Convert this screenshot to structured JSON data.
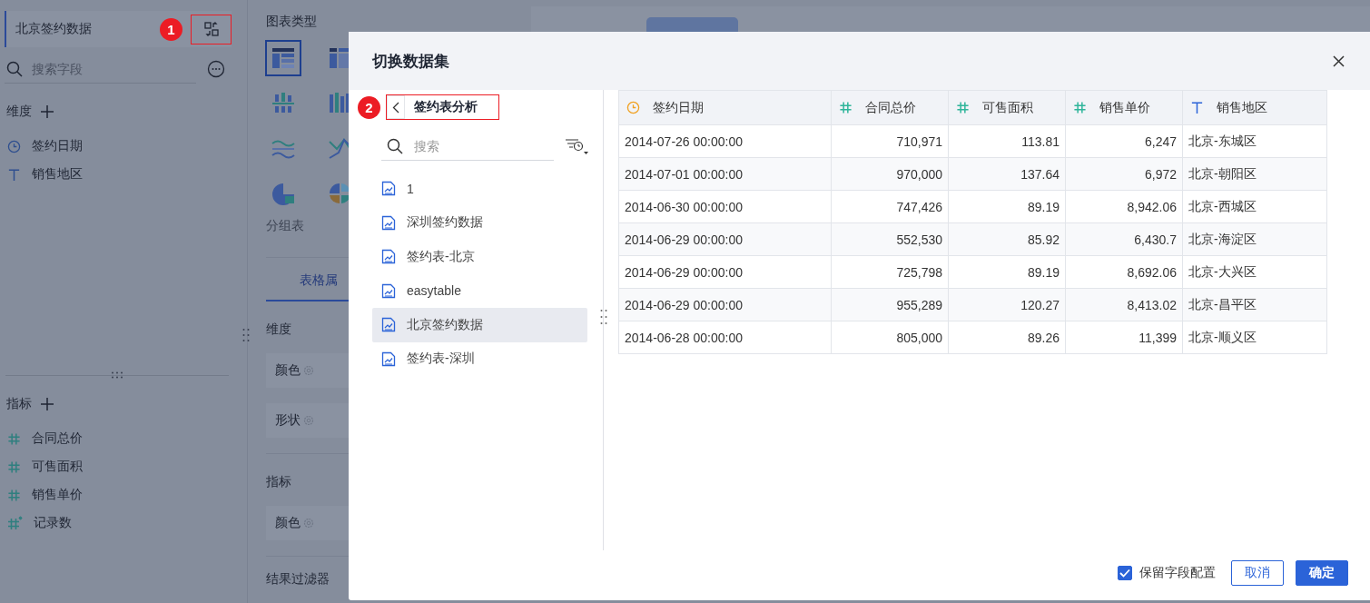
{
  "dataset_panel": {
    "dataset_name": "北京签约数据",
    "search": {
      "placeholder": "搜索字段"
    },
    "dimensions": {
      "title": "维度",
      "fields": [
        {
          "kind": "date",
          "name": "签约日期"
        },
        {
          "kind": "text",
          "name": "销售地区"
        }
      ]
    },
    "measures": {
      "title": "指标",
      "fields": [
        {
          "kind": "number",
          "name": "合同总价"
        },
        {
          "kind": "number",
          "name": "可售面积"
        },
        {
          "kind": "number",
          "name": "销售单价"
        },
        {
          "kind": "count",
          "name": "记录数"
        }
      ]
    }
  },
  "chart_panel": {
    "title": "图表类型",
    "chart_types": [
      {
        "kind": "table",
        "selected": true
      },
      {
        "kind": "crosstable",
        "selected": false
      },
      {
        "kind": "grouped-bar",
        "selected": false
      },
      {
        "kind": "stacked-bar",
        "selected": false
      },
      {
        "kind": "wave",
        "selected": false
      },
      {
        "kind": "line",
        "selected": false
      },
      {
        "kind": "pie",
        "selected": false
      },
      {
        "kind": "multi-pie",
        "selected": false
      }
    ],
    "type_label": "分组表",
    "tab": "表格属",
    "sections": [
      {
        "title": "维度",
        "slots": [
          "颜色",
          "形状"
        ]
      },
      {
        "title": "指标",
        "slots": [
          "颜色"
        ]
      }
    ],
    "filter_title": "结果过滤器"
  },
  "dialog": {
    "title": "切换数据集",
    "folder": "签约表分析",
    "search": {
      "placeholder": "搜索"
    },
    "datasets": [
      {
        "name": "1",
        "selected": false
      },
      {
        "name": "深圳签约数据",
        "selected": false
      },
      {
        "name": "签约表-北京",
        "selected": false
      },
      {
        "name": "easytable",
        "selected": false
      },
      {
        "name": "北京签约数据",
        "selected": true
      },
      {
        "name": "签约表-深圳",
        "selected": false
      }
    ],
    "table": {
      "columns": [
        {
          "kind": "date",
          "label": "签约日期"
        },
        {
          "kind": "number",
          "label": "合同总价"
        },
        {
          "kind": "number",
          "label": "可售面积"
        },
        {
          "kind": "number",
          "label": "销售单价"
        },
        {
          "kind": "text",
          "label": "销售地区"
        }
      ],
      "rows": [
        [
          "2014-07-26 00:00:00",
          "710,971",
          "113.81",
          "6,247",
          "北京-东城区"
        ],
        [
          "2014-07-01 00:00:00",
          "970,000",
          "137.64",
          "6,972",
          "北京-朝阳区"
        ],
        [
          "2014-06-30 00:00:00",
          "747,426",
          "89.19",
          "8,942.06",
          "北京-西城区"
        ],
        [
          "2014-06-29 00:00:00",
          "552,530",
          "85.92",
          "6,430.7",
          "北京-海淀区"
        ],
        [
          "2014-06-29 00:00:00",
          "725,798",
          "89.19",
          "8,692.06",
          "北京-大兴区"
        ],
        [
          "2014-06-29 00:00:00",
          "955,289",
          "120.27",
          "8,413.02",
          "北京-昌平区"
        ],
        [
          "2014-06-28 00:00:00",
          "805,000",
          "89.26",
          "11,399",
          "北京-顺义区"
        ]
      ]
    },
    "keep_config": {
      "label": "保留字段配置",
      "checked": true
    },
    "buttons": [
      {
        "kind": "secondary",
        "label": "取消"
      },
      {
        "kind": "primary",
        "label": "确定"
      }
    ]
  },
  "callouts": [
    "1",
    "2"
  ]
}
